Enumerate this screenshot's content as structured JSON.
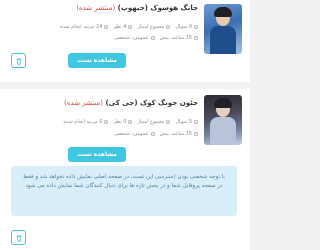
{
  "items": [
    {
      "title": "جانگ هوسوک (جیهوپ)",
      "status": "(منتشر شده)",
      "meta_row1": [
        "0 سوال",
        "مجموع امتیاز",
        "4 نظر",
        "24 مرتبه انجام شده"
      ],
      "meta_row2": [
        "15 ساعت پیش",
        "عمومی: شخصی"
      ],
      "view_label": "مشاهده تست"
    },
    {
      "title": "جئون جونگ کوک (جی کی)",
      "status": "(منتشر شده)",
      "meta_row1": [
        "5 سوال",
        "مجموع امتیاز",
        "0 نظر",
        "0 مرتبه انجام شده"
      ],
      "meta_row2": [
        "15 ساعت پیش",
        "عمومی: شخصی"
      ],
      "view_label": "مشاهده تست",
      "notice": "با توجه شخصی بودن (سترسی این تست، در صفحه اصلی نمایش داده نخواهد شد و فقط در صفحه پروفایل شما و در بخش تازه ها برای دنبال کنندگان شما نمایش داده می شود"
    }
  ],
  "colors": {
    "accent": "#3fc6e0",
    "status": "#e0483a",
    "notice_bg": "#d8eef8"
  }
}
